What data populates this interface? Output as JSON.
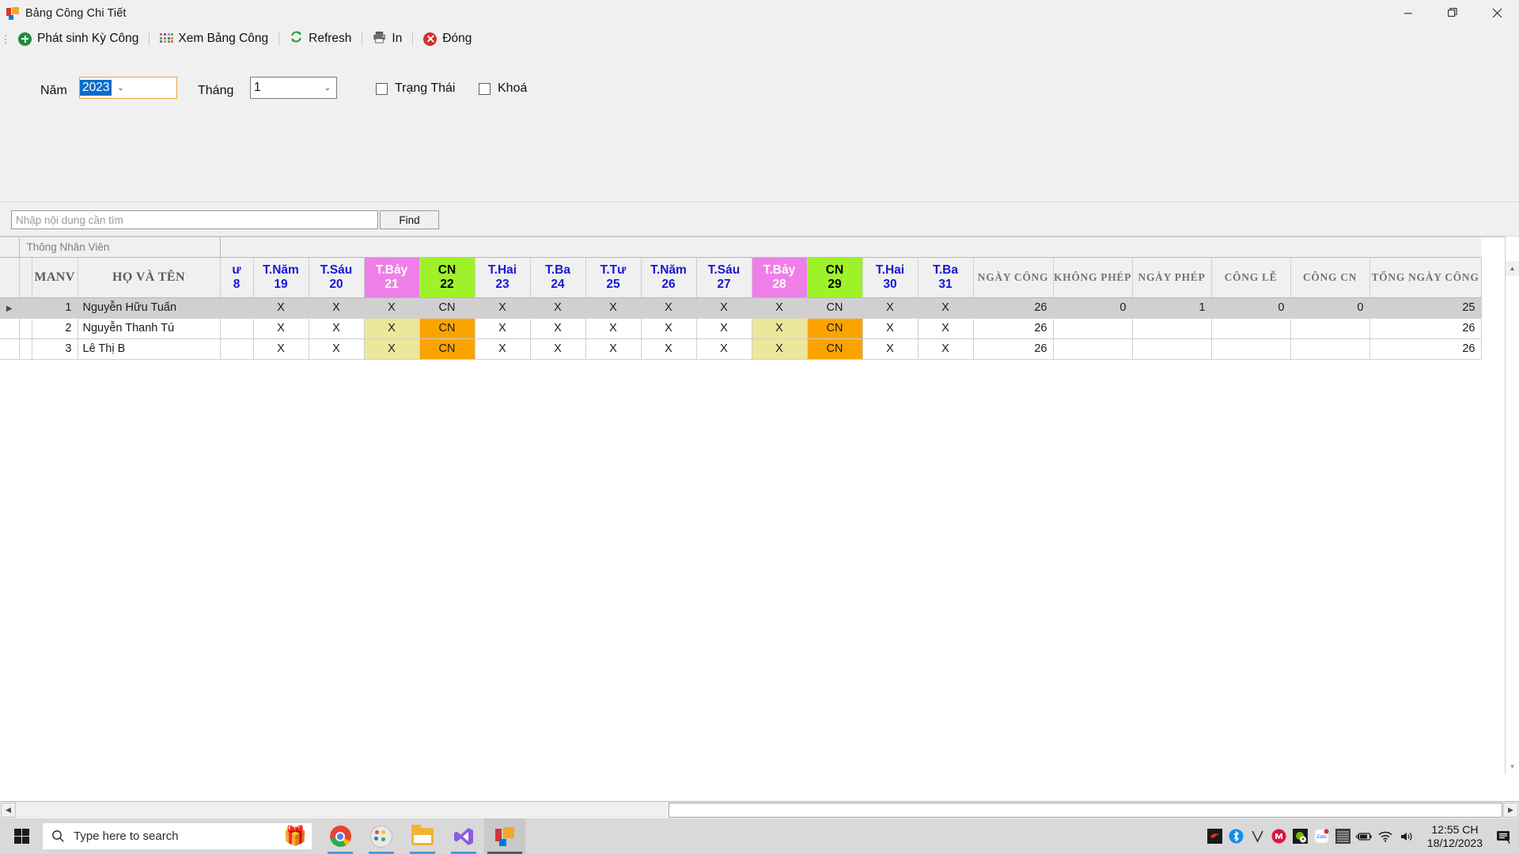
{
  "window": {
    "title": "Bảng Công Chi Tiết",
    "icon": "app-tiles-icon",
    "controls": {
      "minimize": "minimize-icon",
      "maximize": "maximize-icon",
      "close": "close-icon"
    },
    "overflow": "chevron-down-icon"
  },
  "toolbar": {
    "grip": "drag-grip-icon",
    "items": [
      {
        "label": "Phát sinh Kỳ Công",
        "icon": "plus-circle-icon"
      },
      {
        "label": "Xem Bảng Công",
        "icon": "grid-tiles-icon"
      },
      {
        "label": "Refresh",
        "icon": "refresh-icon"
      },
      {
        "label": "In",
        "icon": "printer-icon"
      },
      {
        "label": "Đóng",
        "icon": "close-circle-icon"
      }
    ]
  },
  "filters": {
    "year_label": "Năm",
    "year_value": "2023",
    "month_label": "Tháng",
    "month_value": "1",
    "status_checkbox": {
      "label": "Trạng Thái",
      "checked": false
    },
    "lock_checkbox": {
      "label": "Khoá",
      "checked": false
    }
  },
  "search": {
    "placeholder": "Nhập nội dung cần tìm",
    "value": "",
    "find_label": "Find"
  },
  "grid": {
    "band_label": "Thông Nhân Viên",
    "info_headers": [
      "MANV",
      "HỌ VÀ TÊN"
    ],
    "day_columns": [
      {
        "dow": "ư",
        "num": "8",
        "kind": "clipped"
      },
      {
        "dow": "T.Năm",
        "num": "19",
        "kind": "weekday"
      },
      {
        "dow": "T.Sáu",
        "num": "20",
        "kind": "weekday"
      },
      {
        "dow": "T.Bảy",
        "num": "21",
        "kind": "sat"
      },
      {
        "dow": "CN",
        "num": "22",
        "kind": "sun"
      },
      {
        "dow": "T.Hai",
        "num": "23",
        "kind": "weekday"
      },
      {
        "dow": "T.Ba",
        "num": "24",
        "kind": "weekday"
      },
      {
        "dow": "T.Tư",
        "num": "25",
        "kind": "weekday"
      },
      {
        "dow": "T.Năm",
        "num": "26",
        "kind": "weekday"
      },
      {
        "dow": "T.Sáu",
        "num": "27",
        "kind": "weekday"
      },
      {
        "dow": "T.Bảy",
        "num": "28",
        "kind": "sat"
      },
      {
        "dow": "CN",
        "num": "29",
        "kind": "sun"
      },
      {
        "dow": "T.Hai",
        "num": "30",
        "kind": "weekday"
      },
      {
        "dow": "T.Ba",
        "num": "31",
        "kind": "weekday"
      }
    ],
    "summary_headers": [
      "NGÀY CÔNG",
      "KHÔNG PHÉP",
      "NGÀY PHÉP",
      "CÔNG LỄ",
      "CÔNG CN",
      "TỔNG NGÀY CÔNG"
    ],
    "rows": [
      {
        "selected": true,
        "manv": "1",
        "name": "Nguyễn Hữu Tuấn",
        "days": [
          "",
          "X",
          "X",
          "X",
          "CN",
          "X",
          "X",
          "X",
          "X",
          "X",
          "X",
          "CN",
          "X",
          "X"
        ],
        "summary": [
          "26",
          "0",
          "1",
          "0",
          "0",
          "25"
        ]
      },
      {
        "selected": false,
        "manv": "2",
        "name": "Nguyễn Thanh Tú",
        "days": [
          "",
          "X",
          "X",
          "X",
          "CN",
          "X",
          "X",
          "X",
          "X",
          "X",
          "X",
          "CN",
          "X",
          "X"
        ],
        "summary": [
          "26",
          "",
          "",
          "",
          "",
          "26"
        ]
      },
      {
        "selected": false,
        "manv": "3",
        "name": "Lê Thị B",
        "days": [
          "",
          "X",
          "X",
          "X",
          "CN",
          "X",
          "X",
          "X",
          "X",
          "X",
          "X",
          "CN",
          "X",
          "X"
        ],
        "summary": [
          "26",
          "",
          "",
          "",
          "",
          "26"
        ]
      }
    ],
    "colors": {
      "saturday_header": "#ef7fe8",
      "sunday_header": "#9ef229",
      "saturday_cell": "#ece79b",
      "sunday_cell": "#fba400",
      "selected_row": "#d0d0d0",
      "day_header_text": "#1717d6"
    }
  },
  "scrollbars": {
    "h_left": "scroll-left-icon",
    "h_right": "scroll-right-icon",
    "v_up": "scroll-up-icon",
    "v_down": "scroll-down-icon"
  },
  "taskbar": {
    "start": "windows-start-icon",
    "search_placeholder": "Type here to search",
    "gift_icon": "gift-icon",
    "apps": [
      {
        "name": "chrome-taskbar-icon"
      },
      {
        "name": "paint-taskbar-icon"
      },
      {
        "name": "file-explorer-taskbar-icon"
      },
      {
        "name": "visual-studio-taskbar-icon"
      },
      {
        "name": "bang-cong-taskbar-icon"
      }
    ],
    "tray": [
      "garena-tray-icon",
      "bluetooth-tray-icon",
      "unikey-tray-icon",
      "mcafee-tray-icon",
      "nvidia-tray-icon",
      "zalo-tray-icon",
      "teamviewer-tray-icon",
      "battery-tray-icon",
      "wifi-tray-icon",
      "volume-tray-icon"
    ],
    "time": "12:55 CH",
    "date": "18/12/2023",
    "notifications": "action-center-icon"
  }
}
